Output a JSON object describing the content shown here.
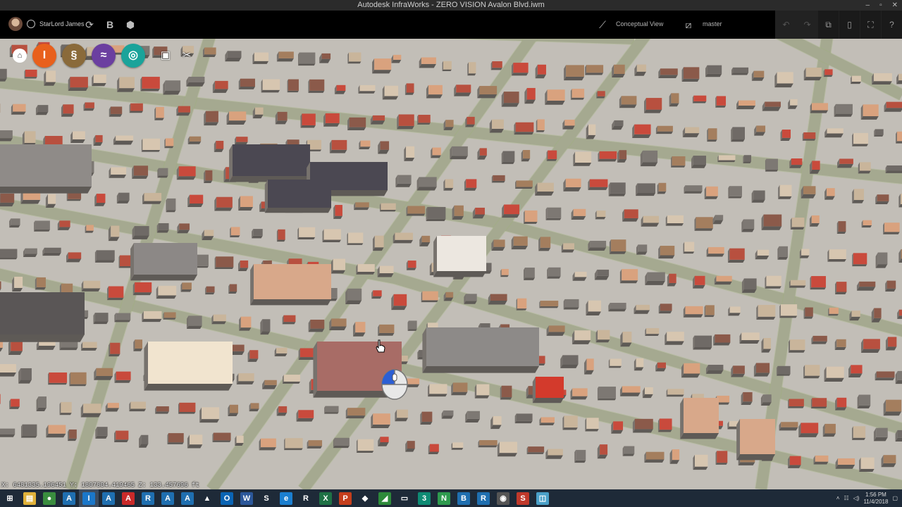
{
  "window": {
    "title": "Autodesk InfraWorks - ZERO VISION Avalon Blvd.iwm",
    "controls": [
      "–",
      "▫",
      "✕"
    ]
  },
  "toolbar": {
    "user_name": "StarLord James",
    "view_mode": "Conceptual View",
    "proposal": "master",
    "left_icons": [
      "sync-icon",
      "bim360-icon",
      "model-icon"
    ],
    "right_icons": [
      "undo-icon",
      "redo-icon",
      "export-icon",
      "bookmark-icon",
      "fullscreen-icon",
      "help-icon"
    ]
  },
  "floating_tools": {
    "home_icon": "⌂",
    "circles": [
      {
        "name": "roads-tool",
        "glyph": "I",
        "color": "#e8601c"
      },
      {
        "name": "drainage-tool",
        "glyph": "§",
        "color": "#8a6a3a"
      },
      {
        "name": "bridge-tool",
        "glyph": "≈",
        "color": "#6b3fa0"
      },
      {
        "name": "analysis-tool",
        "glyph": "◎",
        "color": "#1aa39a"
      }
    ],
    "extra_icons": [
      "present-icon",
      "settings-tools-icon"
    ]
  },
  "viewport": {
    "coords_text": "X: 6481335.196451  Y: 1807804.419465  Z: 133.457696 ft"
  },
  "taskbar": {
    "apps": [
      {
        "name": "start",
        "glyph": "⊞",
        "color": "#1e2a38",
        "active": false
      },
      {
        "name": "file-explorer",
        "glyph": "▤",
        "color": "#e0b23a",
        "active": false
      },
      {
        "name": "chrome",
        "glyph": "●",
        "color": "#3a8d3f",
        "active": false
      },
      {
        "name": "autocad",
        "glyph": "A",
        "color": "#1f6fb0",
        "active": false
      },
      {
        "name": "infraworks",
        "glyph": "I",
        "color": "#1b77c9",
        "active": true
      },
      {
        "name": "autocad-2",
        "glyph": "A",
        "color": "#1f6fb0",
        "active": false
      },
      {
        "name": "autocad-3",
        "glyph": "A",
        "color": "#c92a2a",
        "active": false
      },
      {
        "name": "revit",
        "glyph": "R",
        "color": "#1f6fb0",
        "active": false
      },
      {
        "name": "autocad-4",
        "glyph": "A",
        "color": "#1f6fb0",
        "active": false
      },
      {
        "name": "civil3d",
        "glyph": "A",
        "color": "#1f6fb0",
        "active": false
      },
      {
        "name": "azure",
        "glyph": "▲",
        "color": "#1e2a38",
        "active": false
      },
      {
        "name": "outlook",
        "glyph": "O",
        "color": "#0a64b4",
        "active": false
      },
      {
        "name": "word",
        "glyph": "W",
        "color": "#2b579a",
        "active": false
      },
      {
        "name": "skype",
        "glyph": "S",
        "color": "#1e2a38",
        "active": false
      },
      {
        "name": "edge",
        "glyph": "e",
        "color": "#1b7fd0",
        "active": false
      },
      {
        "name": "recap",
        "glyph": "R",
        "color": "#1e2a38",
        "active": false
      },
      {
        "name": "excel",
        "glyph": "X",
        "color": "#1e7145",
        "active": false
      },
      {
        "name": "powerpoint",
        "glyph": "P",
        "color": "#c43e1c",
        "active": false
      },
      {
        "name": "navisworks",
        "glyph": "◆",
        "color": "#1e2a38",
        "active": false
      },
      {
        "name": "green-app",
        "glyph": "◢",
        "color": "#2d8a3a",
        "active": false
      },
      {
        "name": "screen-app",
        "glyph": "▭",
        "color": "#1e2a38",
        "active": false
      },
      {
        "name": "3dsmax",
        "glyph": "3",
        "color": "#0e8b74",
        "active": false
      },
      {
        "name": "onenote",
        "glyph": "N",
        "color": "#2e9a4e",
        "active": false
      },
      {
        "name": "bim360",
        "glyph": "B",
        "color": "#1f6fb0",
        "active": false
      },
      {
        "name": "revit-2",
        "glyph": "R",
        "color": "#1f6fb0",
        "active": false
      },
      {
        "name": "app-circle",
        "glyph": "◉",
        "color": "#555",
        "active": false
      },
      {
        "name": "snagit",
        "glyph": "S",
        "color": "#c0392b",
        "active": false
      },
      {
        "name": "note-app",
        "glyph": "◫",
        "color": "#4aa0c8",
        "active": false
      }
    ],
    "tray": {
      "time": "1:56 PM",
      "date": "11/4/2018"
    }
  }
}
